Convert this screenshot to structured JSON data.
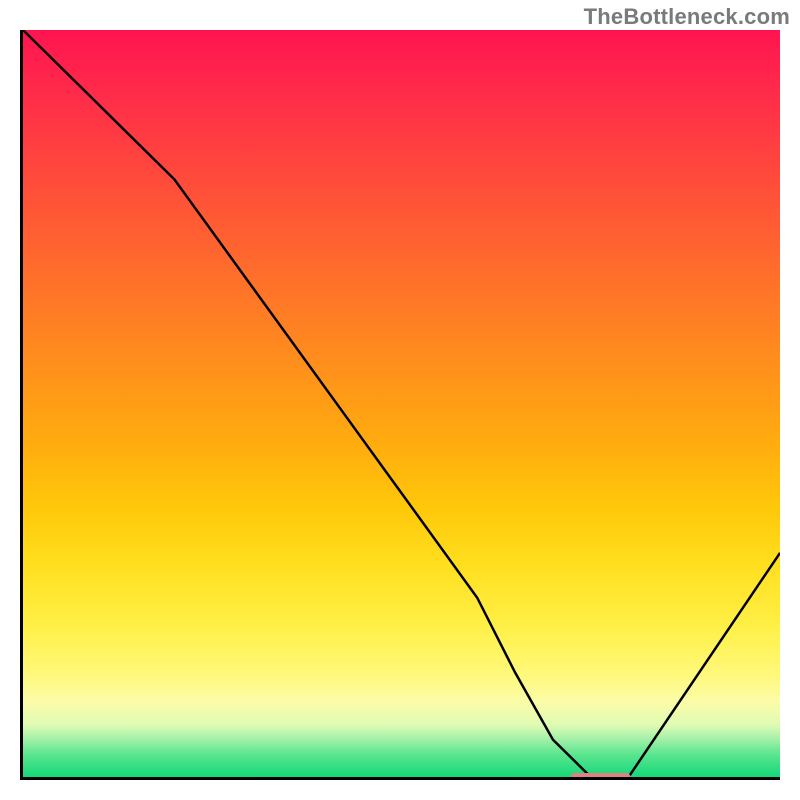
{
  "watermark": "TheBottleneck.com",
  "chart_data": {
    "type": "line",
    "title": "",
    "xlabel": "",
    "ylabel": "",
    "xlim": [
      0,
      100
    ],
    "ylim": [
      0,
      100
    ],
    "x": [
      0,
      8,
      20,
      30,
      40,
      50,
      60,
      65,
      70,
      75,
      80,
      90,
      100
    ],
    "values": [
      100,
      92,
      80,
      66,
      52,
      38,
      24,
      14,
      5,
      0,
      0,
      15,
      30
    ],
    "marker": {
      "x_start": 72,
      "x_end": 80,
      "y": 0
    },
    "annotations": []
  },
  "colors": {
    "axis": "#000000",
    "curve": "#000000",
    "marker": "#e08080",
    "watermark": "#7a7a7a"
  }
}
